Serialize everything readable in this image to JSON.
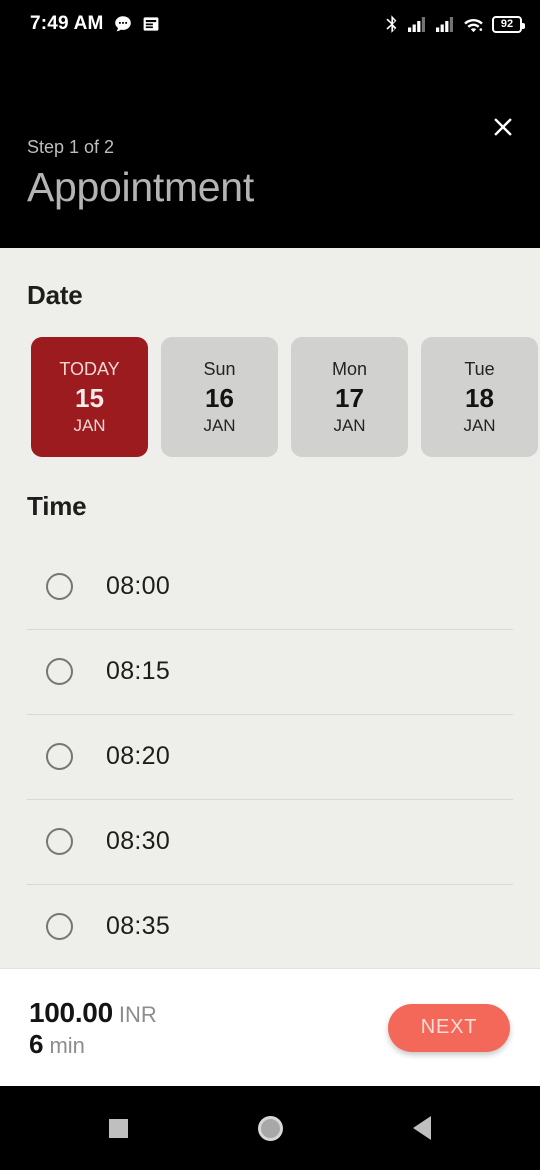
{
  "status_bar": {
    "time": "7:49 AM",
    "left_icons": [
      "chat-bubble-icon",
      "article-icon"
    ],
    "right_icons": [
      "bluetooth-icon",
      "signal-sim1-icon",
      "signal-sim2-icon",
      "wifi-icon"
    ],
    "battery_level": "92"
  },
  "header": {
    "close_icon": "close-icon",
    "step_label": "Step 1 of 2",
    "title": "Appointment",
    "background_color": "#000000",
    "text_color": "#b4b4b4"
  },
  "date_section": {
    "title": "Date",
    "selected_index": 0,
    "selected_color": "#9c1b1f",
    "card_color": "#d1d1cf",
    "cards": [
      {
        "day": "TODAY",
        "num": "15",
        "month": "JAN",
        "selected": true
      },
      {
        "day": "Sun",
        "num": "16",
        "month": "JAN",
        "selected": false
      },
      {
        "day": "Mon",
        "num": "17",
        "month": "JAN",
        "selected": false
      },
      {
        "day": "Tue",
        "num": "18",
        "month": "JAN",
        "selected": false
      }
    ]
  },
  "time_section": {
    "title": "Time",
    "selected_index": null,
    "slots": [
      {
        "label": "08:00",
        "selected": false
      },
      {
        "label": "08:15",
        "selected": false
      },
      {
        "label": "08:20",
        "selected": false
      },
      {
        "label": "08:30",
        "selected": false
      },
      {
        "label": "08:35",
        "selected": false
      }
    ]
  },
  "bottom_bar": {
    "price_amount": "100.00",
    "price_currency": "INR",
    "duration_value": "6",
    "duration_unit": "min",
    "next_label": "NEXT",
    "next_color": "#f4685a"
  },
  "nav_bar": {
    "recents_icon": "square-icon",
    "home_icon": "circle-icon",
    "back_icon": "triangle-left-icon"
  }
}
